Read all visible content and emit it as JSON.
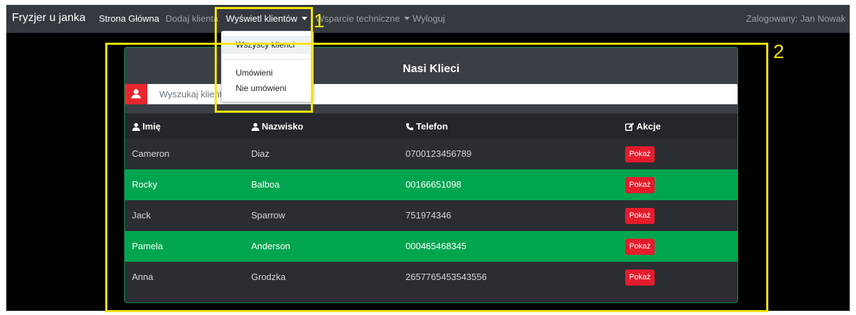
{
  "navbar": {
    "brand": "Fryzjer u janka",
    "links": [
      "Strona Główna",
      "Dodaj klienta",
      "Wyświetl klientów",
      "Wsparcie techniczne",
      "Wyloguj"
    ],
    "user_status": "Zalogowany: Jan Nowak"
  },
  "dropdown": {
    "items": [
      "Wszyscy klienci",
      "Umówieni",
      "Nie umówieni"
    ]
  },
  "card": {
    "title": "Nasi Klieci",
    "search_placeholder": "Wyszukaj klienta"
  },
  "table": {
    "headers": [
      "Imię",
      "Nazwisko",
      "Telefon",
      "Akcje"
    ],
    "rows": [
      {
        "first": "Cameron",
        "last": "Diaz",
        "phone": "0700123456789",
        "action": "Pokaż",
        "highlight": false
      },
      {
        "first": "Rocky",
        "last": "Balboa",
        "phone": "00166651098",
        "action": "Pokaż",
        "highlight": true
      },
      {
        "first": "Jack",
        "last": "Sparrow",
        "phone": "751974346",
        "action": "Pokaż",
        "highlight": false
      },
      {
        "first": "Pamela",
        "last": "Anderson",
        "phone": "000465468345",
        "action": "Pokaż",
        "highlight": true
      },
      {
        "first": "Anna",
        "last": "Grodzka",
        "phone": "2657765453543556",
        "action": "Pokaż",
        "highlight": false
      }
    ]
  },
  "annotations": [
    "1",
    "2"
  ],
  "colors": {
    "navbar": "#343a40",
    "highlight_row": "#00a54f",
    "action_button": "#e41c2c",
    "annotation": "#f6e400"
  },
  "icons": [
    "user-icon",
    "phone-icon",
    "edit-icon",
    "caret-down-icon"
  ]
}
